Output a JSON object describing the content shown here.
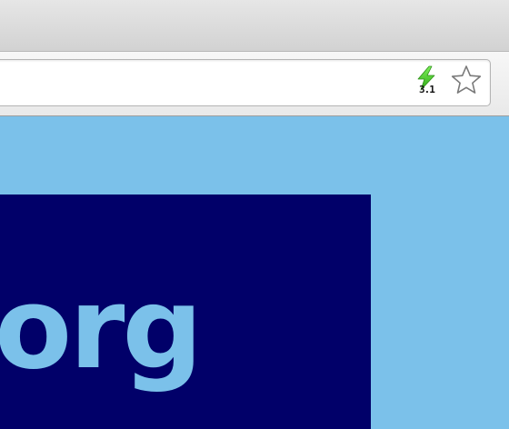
{
  "browser": {
    "extension": {
      "icon": "lightning-bolt-icon",
      "badge": "3.1",
      "color": "#3fbf1f"
    },
    "bookmark": {
      "icon": "star-icon"
    }
  },
  "page": {
    "background": "#7bc1ea",
    "logo": {
      "text": "org",
      "background": "#010069",
      "text_color": "#7bc1ea"
    }
  }
}
